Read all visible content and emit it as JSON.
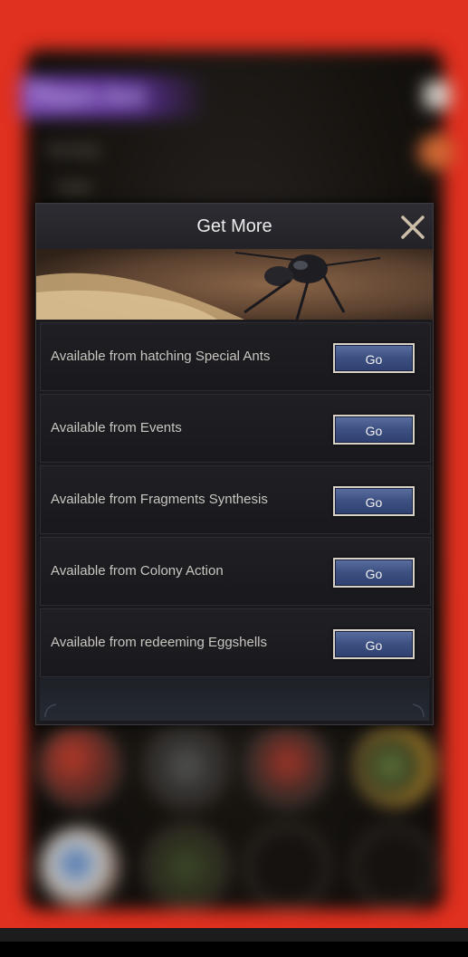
{
  "background": {
    "title": "Thorn Ant",
    "menu_item_1": "Develop",
    "menu_item_2": "Trade"
  },
  "dialog": {
    "title": "Get More",
    "rows": [
      {
        "label": "Available from hatching Special Ants",
        "button": "Go"
      },
      {
        "label": "Available from Events",
        "button": "Go"
      },
      {
        "label": "Available from Fragments Synthesis",
        "button": "Go"
      },
      {
        "label": "Available from Colony Action",
        "button": "Go"
      },
      {
        "label": "Available from redeeming Eggshells",
        "button": "Go"
      }
    ]
  },
  "colors": {
    "frame": "#e0301f",
    "button_fill": "#3c4f80",
    "button_border": "#d8d2c6"
  }
}
